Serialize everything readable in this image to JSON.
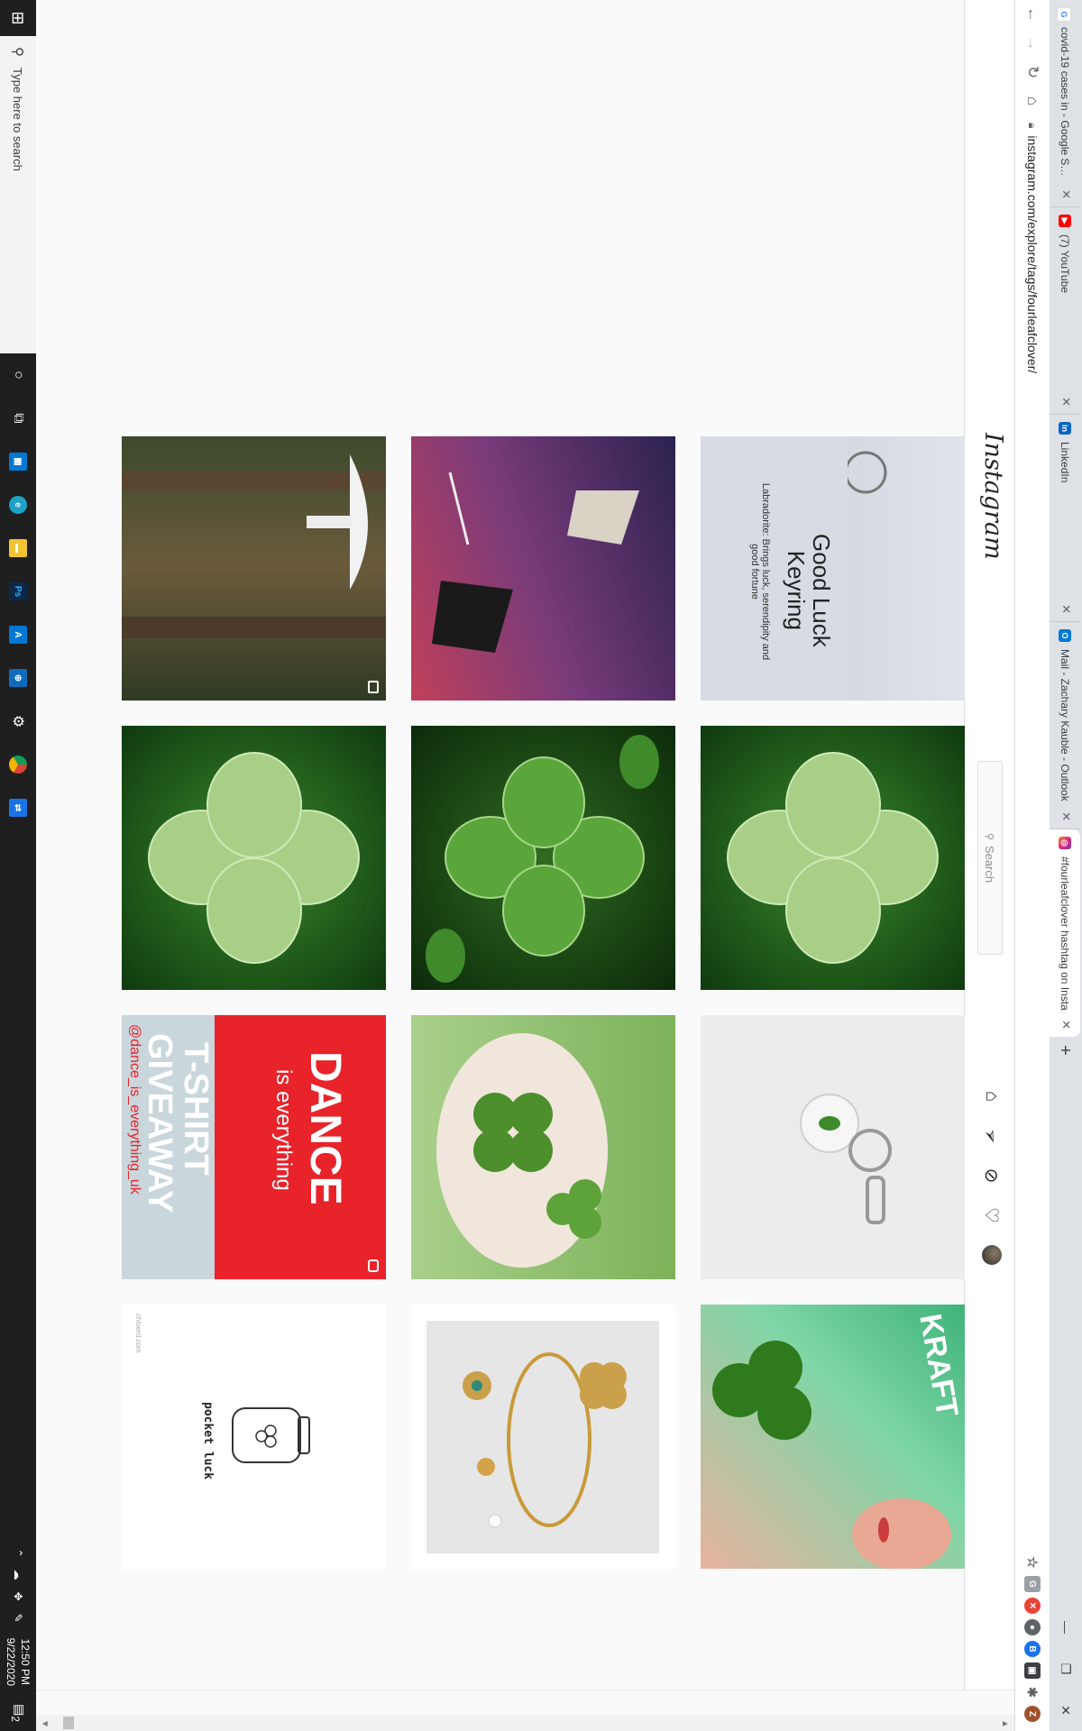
{
  "browser": {
    "tabs": [
      {
        "title": "covid-19 cases in - Google Searc",
        "favicon": "google-icon",
        "color": "#4285f4",
        "letter": "G",
        "active": false
      },
      {
        "title": "(7) YouTube",
        "favicon": "youtube-icon",
        "color": "#ff0000",
        "letter": "▶",
        "active": false
      },
      {
        "title": "LinkedIn",
        "favicon": "linkedin-icon",
        "color": "#0a66c2",
        "letter": "in",
        "active": false
      },
      {
        "title": "Mail - Zachary Kauble - Outlook",
        "favicon": "outlook-icon",
        "color": "#0078d4",
        "letter": "O",
        "active": false
      },
      {
        "title": "#fourleafclover hashtag on Insta",
        "favicon": "instagram-icon",
        "color": "#d6249f",
        "letter": "◎",
        "active": true
      }
    ],
    "new_tab": "+",
    "url": "instagram.com/explore/tags/fourleafclover/",
    "window_controls": [
      "—",
      "❐",
      "✕"
    ],
    "extensions": [
      {
        "name": "star-icon",
        "glyph": "☆",
        "color": "#5f6368"
      },
      {
        "name": "g-extension-icon",
        "glyph": "G",
        "color": "#9aa0a6"
      },
      {
        "name": "red-extension-icon",
        "glyph": "✕",
        "color": "#ea4335"
      },
      {
        "name": "dark-extension-icon",
        "glyph": "●",
        "color": "#5f6368"
      },
      {
        "name": "blue-extension-icon",
        "glyph": "B",
        "color": "#1a73e8"
      },
      {
        "name": "photo-extension-icon",
        "glyph": "▣",
        "color": "#3c4043"
      },
      {
        "name": "puzzle-icon",
        "glyph": "✱",
        "color": "#5f6368"
      },
      {
        "name": "profile-icon",
        "glyph": "Z",
        "color": "#a0522d"
      }
    ]
  },
  "instagram": {
    "logo": "Instagram",
    "search_placeholder": "Search",
    "nav": [
      "home-icon",
      "direct-icon",
      "explore-icon",
      "activity-icon",
      "profile-avatar"
    ]
  },
  "grid": {
    "posts": [
      {
        "id": "keyring-card",
        "text_title": "Good Luck\nKeyring",
        "text_sub": "Labradorite: Brings luck, serendipity and good fortune"
      },
      {
        "id": "dew-clover-1"
      },
      {
        "id": "resin-keychain"
      },
      {
        "id": "clover-in-hand-shirt",
        "shirt_text": "KRAFT"
      },
      {
        "id": "anime-art"
      },
      {
        "id": "clover-patch"
      },
      {
        "id": "clovers-on-palm"
      },
      {
        "id": "gold-bracelet"
      },
      {
        "id": "mushroom-forest"
      },
      {
        "id": "dew-clover-2"
      },
      {
        "id": "dance-tshirt",
        "big": "DANCE",
        "small": "is everything",
        "tshirt": "T-SHIRT",
        "giveaway": "GIVEAWAY",
        "handle": "@dance_is_everything_uk"
      },
      {
        "id": "pocket-luck",
        "caption": "pocket luck",
        "credit": "chloerd.com"
      }
    ]
  },
  "taskbar": {
    "search_placeholder": "Type here to search",
    "time": "12:50 PM",
    "date": "9/22/2020",
    "notification_count": "2"
  }
}
